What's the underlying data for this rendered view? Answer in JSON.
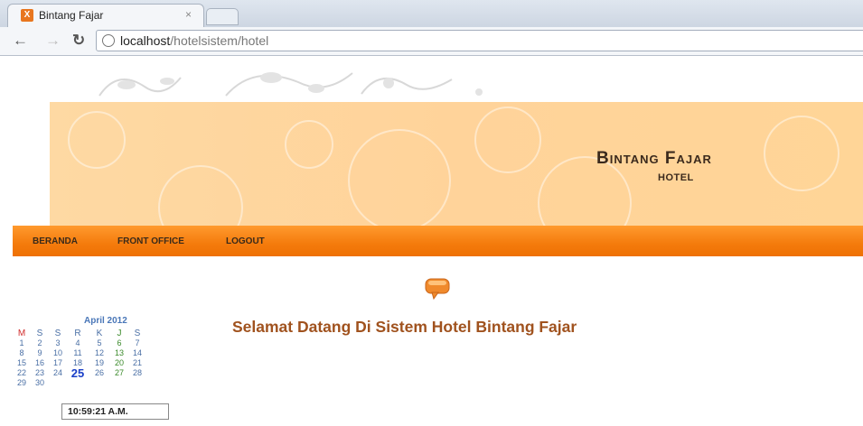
{
  "browser": {
    "tab_title": "Bintang Fajar",
    "tab_close": "×",
    "url_host": "localhost",
    "url_path": "/hotelsistem/hotel"
  },
  "header": {
    "hotel_name": "Bintang Fajar",
    "hotel_sub": "HOTEL"
  },
  "menu": {
    "items": [
      "BERANDA",
      "FRONT OFFICE",
      "LOGOUT"
    ]
  },
  "main": {
    "welcome": "Selamat Datang Di Sistem Hotel Bintang Fajar"
  },
  "calendar": {
    "month": "April 2012",
    "weekdays": [
      "M",
      "S",
      "S",
      "R",
      "K",
      "J",
      "S"
    ],
    "weeks": [
      [
        "1",
        "2",
        "3",
        "4",
        "5",
        "6",
        "7"
      ],
      [
        "8",
        "9",
        "10",
        "11",
        "12",
        "13",
        "14"
      ],
      [
        "15",
        "16",
        "17",
        "18",
        "19",
        "20",
        "21"
      ],
      [
        "22",
        "23",
        "24",
        "25",
        "26",
        "27",
        "28"
      ],
      [
        "29",
        "30",
        "",
        "",
        "",
        "",
        ""
      ]
    ],
    "today": "25",
    "clock": "10:59:21 A.M."
  },
  "colors": {
    "banner": "#fed9a3",
    "menubar": "#f47b0c",
    "welcome": "#a0521e"
  }
}
